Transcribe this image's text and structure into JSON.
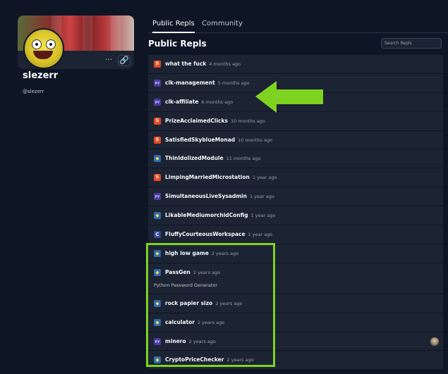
{
  "profile": {
    "username": "slezerr",
    "handle": "@slezerr",
    "more_label": "···",
    "link_label": "🔗"
  },
  "tabs": [
    {
      "label": "Public Repls",
      "active": true
    },
    {
      "label": "Community",
      "active": false
    }
  ],
  "section_title": "Public Repls",
  "search": {
    "placeholder": "Search Repls"
  },
  "repls": [
    {
      "name": "what the fuck",
      "time": "4 months ago",
      "lang": "html"
    },
    {
      "name": "clk-management",
      "time": "5 months ago",
      "lang": "pygame"
    },
    {
      "name": "clk-affiliate",
      "time": "6 months ago",
      "lang": "pygame"
    },
    {
      "name": "PrizeAcclaimedClicks",
      "time": "10 months ago",
      "lang": "html"
    },
    {
      "name": "SatisfiedSkyblueMonad",
      "time": "10 months ago",
      "lang": "html"
    },
    {
      "name": "ThinIdolizedModule",
      "time": "11 months ago",
      "lang": "python"
    },
    {
      "name": "LimpingMarriedMicrostation",
      "time": "1 year ago",
      "lang": "html"
    },
    {
      "name": "SimultaneousLiveSysadmin",
      "time": "1 year ago",
      "lang": "pygame"
    },
    {
      "name": "LikableMediumorchidConfig",
      "time": "1 year ago",
      "lang": "python"
    },
    {
      "name": "FluffyCourteousWorkspace",
      "time": "1 year ago",
      "lang": "cpp"
    },
    {
      "name": "high low game",
      "time": "2 years ago",
      "lang": "python"
    },
    {
      "name": "PassGen",
      "time": "2 years ago",
      "lang": "python",
      "description": "Python Password Generator"
    },
    {
      "name": "rock papier sizo",
      "time": "2 years ago",
      "lang": "python"
    },
    {
      "name": "calculator",
      "time": "2 years ago",
      "lang": "python"
    },
    {
      "name": "minero",
      "time": "2 years ago",
      "lang": "pygame",
      "has_collaborator": true
    },
    {
      "name": "CryptoPriceChecker",
      "time": "2 years ago",
      "lang": "python"
    }
  ],
  "colors": {
    "background": "#0e1525",
    "card": "#1c2333",
    "annotation": "#7ed321"
  }
}
